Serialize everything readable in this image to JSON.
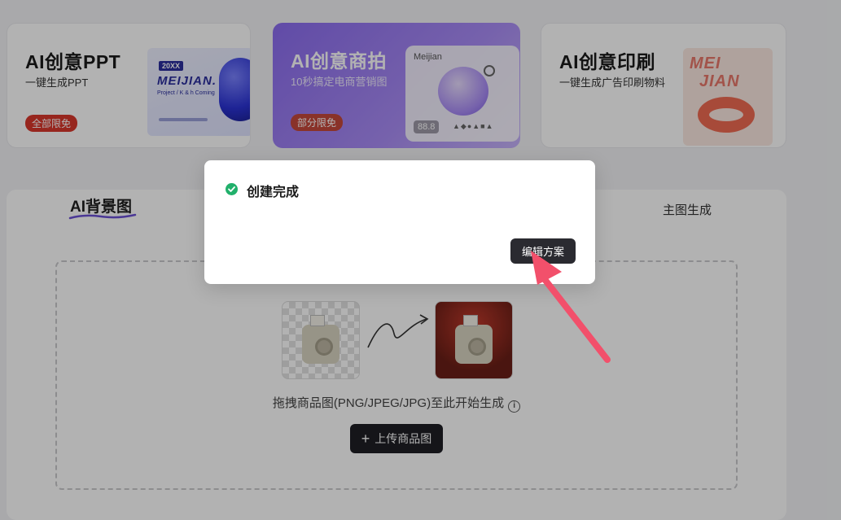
{
  "cards": [
    {
      "title": "AI创意PPT",
      "subtitle": "一键生成PPT",
      "badge": "全部限免",
      "art_tag": "20XX",
      "art_brand": "MEIJIAN.",
      "art_line": "Project / K & h Coming"
    },
    {
      "title": "AI创意商拍",
      "subtitle": "10秒搞定电商营销图",
      "badge": "部分限免",
      "art_label": "Meijian",
      "art_price": "88.8",
      "art_icons": "▲◆●▲■▲"
    },
    {
      "title": "AI创意印刷",
      "subtitle": "一键生成广告印刷物料",
      "art_text_1": "MEI",
      "art_text_2": "JIAN"
    }
  ],
  "tabs": {
    "active": "AI背景图",
    "other": "主图生成"
  },
  "upload": {
    "hint": "拖拽商品图(PNG/JPEG/JPG)至此开始生成",
    "info_glyph": "i",
    "button_plus": "+",
    "button_label": "上传商品图"
  },
  "modal": {
    "title": "创建完成",
    "button_label": "编辑方案"
  },
  "colors": {
    "accent_purple": "#8b6cf0",
    "badge_red": "#d8372c",
    "success_green": "#21b06b",
    "pointer_pink": "#f2506b"
  }
}
